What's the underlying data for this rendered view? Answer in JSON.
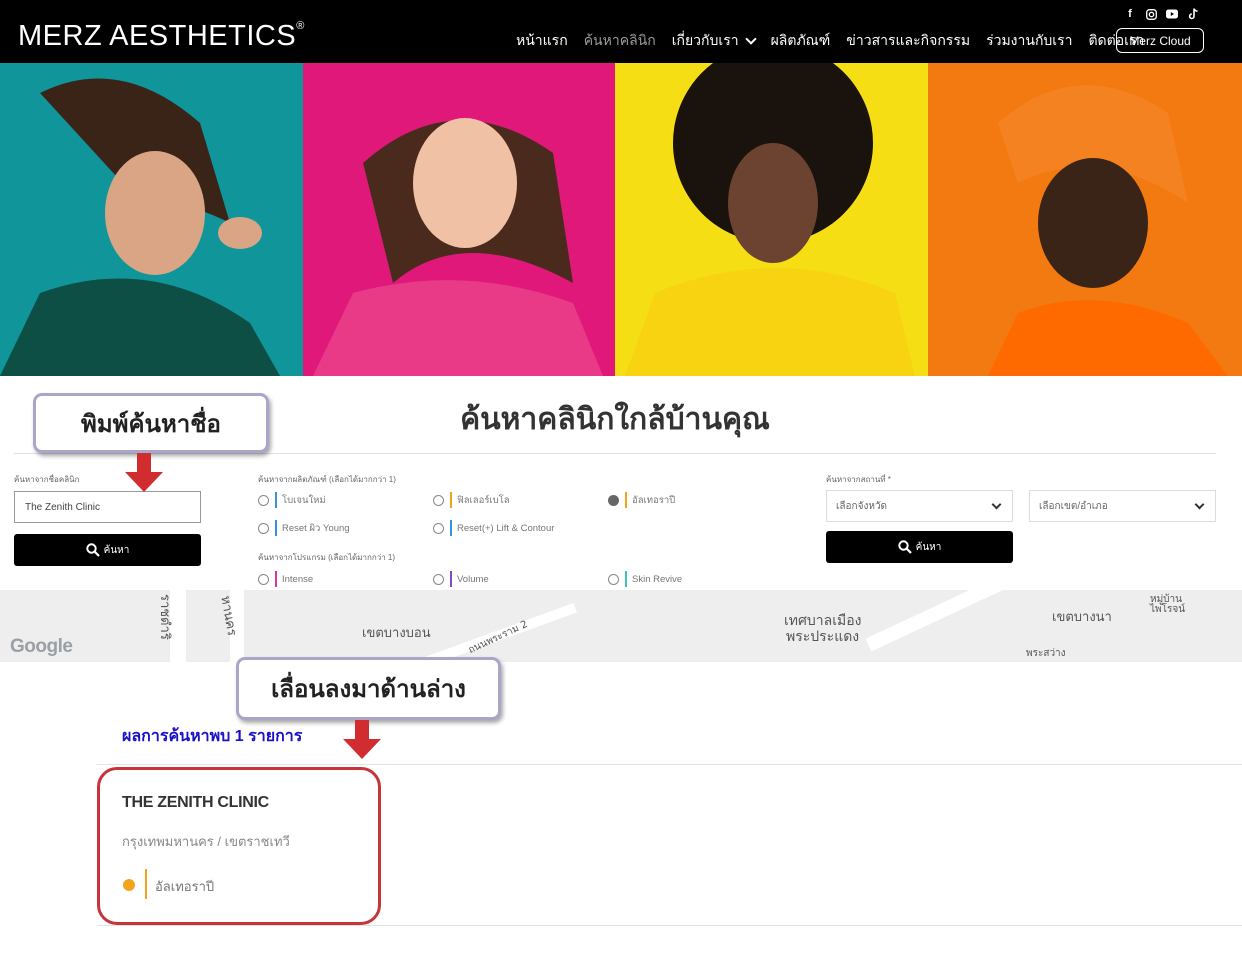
{
  "header": {
    "logo": "MERZ AESTHETICS",
    "logo_mark": "®",
    "nav": [
      {
        "label": "หน้าแรก",
        "active": false
      },
      {
        "label": "ค้นหาคลินิก",
        "active": true
      },
      {
        "label": "เกี่ยวกับเรา",
        "active": false,
        "dropdown": true
      },
      {
        "label": "ผลิตภัณฑ์",
        "active": false
      },
      {
        "label": "ข่าวสารและกิจกรรม",
        "active": false
      },
      {
        "label": "ร่วมงานกับเรา",
        "active": false
      },
      {
        "label": "ติดต่อเรา",
        "active": false
      }
    ],
    "social_icons": [
      "facebook-icon",
      "instagram-icon",
      "youtube-icon",
      "tiktok-icon"
    ],
    "cloud_button": "Merz Cloud"
  },
  "hero": {
    "panel_colors": [
      "#10969a",
      "#e0187a",
      "#f6de14",
      "#f37a10"
    ]
  },
  "search": {
    "title": "ค้นหาคลินิกใกล้บ้านคุณ",
    "name_label": "ค้นหาจากชื่อคลินิก",
    "name_value": "The Zenith Clinic",
    "search_button": "ค้นหา",
    "product_label": "ค้นหาจากผลิตภัณฑ์ (เลือกได้มากกว่า 1)",
    "products": [
      {
        "label": "โบเจนใหม่",
        "color": "#3b8fd9",
        "checked": false
      },
      {
        "label": "ฟิลเลอร์เบโล",
        "color": "#e5a51e",
        "checked": false
      },
      {
        "label": "อัลเทอราปี",
        "color": "#f2a51c",
        "checked": true
      },
      {
        "label": "Reset ผิว Young",
        "color": "#3b8fd9",
        "checked": false
      },
      {
        "label": "Reset(+) Lift & Contour",
        "color": "#3b8fd9",
        "checked": false
      }
    ],
    "type_label": "ค้นหาจากโปรแกรม (เลือกได้มากกว่า 1)",
    "types": [
      {
        "label": "Intense",
        "color": "#d13aa6",
        "checked": false
      },
      {
        "label": "Volume",
        "color": "#8a46c7",
        "checked": false
      },
      {
        "label": "Skin Revive",
        "color": "#3cc6b4",
        "checked": false
      }
    ],
    "location_label": "ค้นหาจากสถานที่ *",
    "province_placeholder": "เลือกจังหวัด",
    "district_placeholder": "เลือกเขต/อำเภอ",
    "location_button": "ค้นหา"
  },
  "map": {
    "labels": [
      "ราชดำริ",
      "หานคร",
      "เขตบางบอน",
      "ถนนพระราม 2",
      "เทศบาลเมือง",
      "พระประแดง",
      "เขตบางนา",
      "หมู่บ้าน",
      "ไพโรจน์",
      "พระสว่าง"
    ],
    "attribution": "Google"
  },
  "results": {
    "count_text": "ผลการค้นหาพบ 1 รายการ",
    "clinic_name": "THE ZENITH CLINIC",
    "clinic_location": "กรุงเทพมหานคร / เขตราชเทวี",
    "clinic_product": "อัลเทอราปี"
  },
  "annotations": {
    "callout_name": "พิมพ์ค้นหาชื่อ",
    "callout_scroll": "เลื่อนลงมาด้านล่าง"
  }
}
